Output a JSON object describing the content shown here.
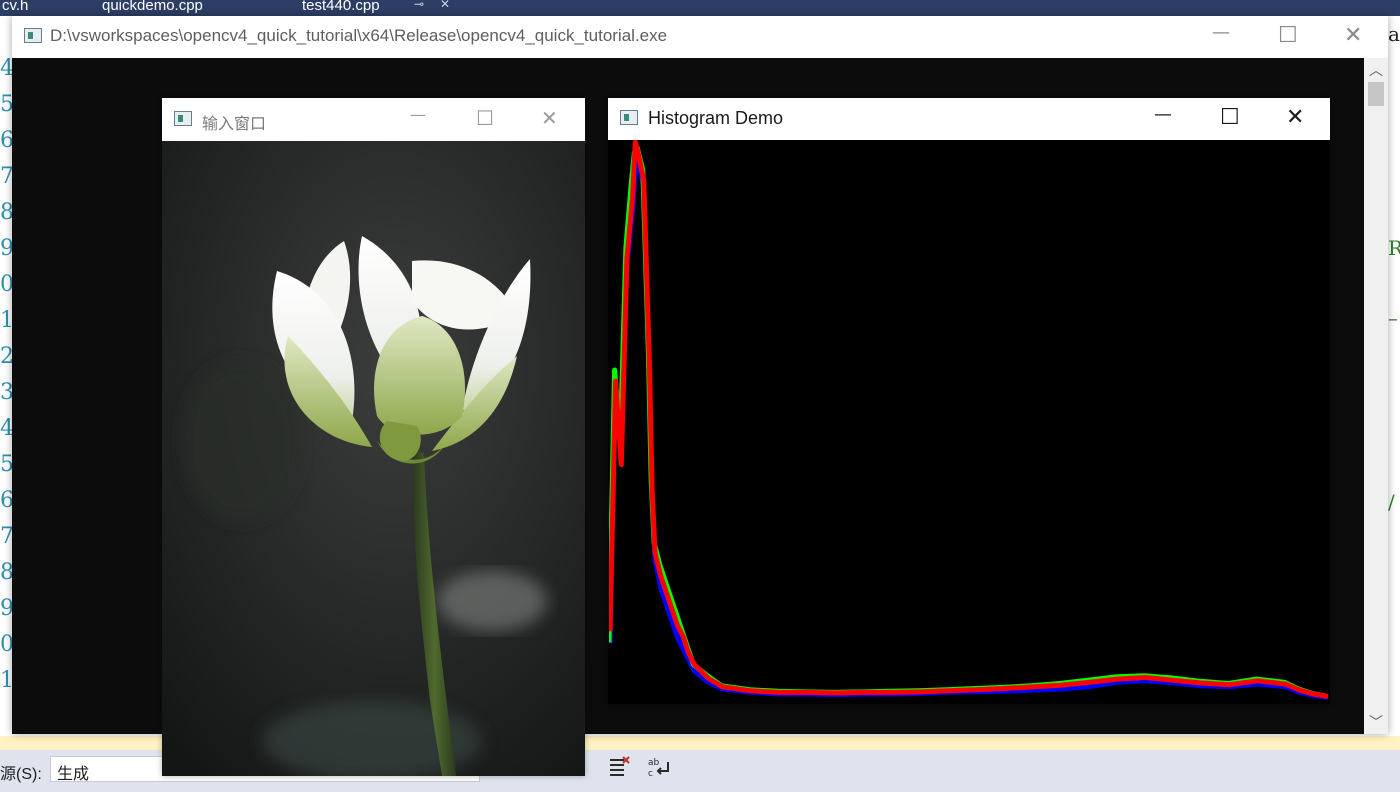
{
  "ide": {
    "tabs": [
      "cv.h",
      "quickdemo.cpp",
      "test440.cpp"
    ],
    "tab_pin": "⊸",
    "tab_close": "✕",
    "line_numbers": [
      "4",
      "5",
      "6",
      "7",
      "8",
      "9",
      "0",
      "1",
      "2",
      "3",
      "4",
      "5",
      "6",
      "7",
      "8",
      "9",
      "0",
      "1"
    ],
    "right_edge_text": [
      "a",
      "R",
      "–",
      "/"
    ],
    "output_label": "源(S):",
    "output_select_value": "生成"
  },
  "console": {
    "title": "D:\\vsworkspaces\\opencv4_quick_tutorial\\x64\\Release\\opencv4_quick_tutorial.exe",
    "minimize": "—",
    "maximize": "☐",
    "close": "✕"
  },
  "input_window": {
    "title": "输入窗口",
    "minimize": "—",
    "maximize": "☐",
    "close": "✕"
  },
  "hist_window": {
    "title": "Histogram Demo",
    "minimize": "—",
    "maximize": "☐",
    "close": "✕"
  },
  "colors": {
    "console_bg": "#0c0c0c",
    "hist_bg": "#000000",
    "blue_channel": "#0000ff",
    "green_channel": "#00ff00",
    "red_channel": "#ff0000"
  },
  "chart_data": {
    "type": "line",
    "title": "",
    "xlabel": "",
    "ylabel": "",
    "xlim": [
      0,
      255
    ],
    "ylim": [
      0,
      1
    ],
    "grid": false,
    "legend": "none",
    "x": [
      0,
      2,
      4,
      6,
      8,
      9,
      10,
      12,
      14,
      15,
      16,
      18,
      20,
      22,
      24,
      26,
      28,
      30,
      35,
      40,
      50,
      60,
      70,
      80,
      90,
      100,
      110,
      120,
      130,
      140,
      150,
      160,
      170,
      180,
      190,
      200,
      210,
      220,
      230,
      240,
      245,
      250,
      255
    ],
    "series": [
      {
        "name": "B",
        "values": [
          0.1,
          0.56,
          0.46,
          0.78,
          0.88,
          0.95,
          0.97,
          0.92,
          0.58,
          0.35,
          0.25,
          0.2,
          0.17,
          0.14,
          0.11,
          0.09,
          0.07,
          0.05,
          0.03,
          0.018,
          0.012,
          0.009,
          0.009,
          0.008,
          0.009,
          0.009,
          0.01,
          0.012,
          0.013,
          0.014,
          0.016,
          0.018,
          0.022,
          0.03,
          0.033,
          0.029,
          0.024,
          0.022,
          0.027,
          0.022,
          0.012,
          0.006,
          0.003
        ]
      },
      {
        "name": "G",
        "values": [
          0.1,
          0.59,
          0.46,
          0.81,
          0.93,
          0.98,
          0.99,
          0.95,
          0.62,
          0.39,
          0.28,
          0.24,
          0.21,
          0.18,
          0.15,
          0.12,
          0.09,
          0.06,
          0.04,
          0.022,
          0.015,
          0.012,
          0.011,
          0.01,
          0.011,
          0.012,
          0.013,
          0.015,
          0.017,
          0.019,
          0.022,
          0.026,
          0.032,
          0.038,
          0.04,
          0.036,
          0.03,
          0.026,
          0.034,
          0.028,
          0.016,
          0.008,
          0.003
        ]
      },
      {
        "name": "R",
        "values": [
          0.12,
          0.57,
          0.42,
          0.79,
          0.9,
          1.0,
          0.98,
          0.93,
          0.6,
          0.37,
          0.26,
          0.22,
          0.19,
          0.16,
          0.13,
          0.11,
          0.08,
          0.06,
          0.035,
          0.02,
          0.013,
          0.01,
          0.01,
          0.009,
          0.01,
          0.01,
          0.011,
          0.013,
          0.015,
          0.017,
          0.02,
          0.023,
          0.028,
          0.034,
          0.037,
          0.032,
          0.027,
          0.024,
          0.031,
          0.025,
          0.014,
          0.007,
          0.003
        ]
      }
    ]
  }
}
